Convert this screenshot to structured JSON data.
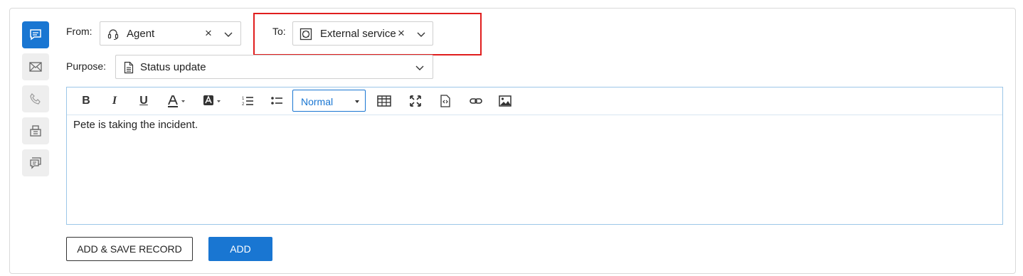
{
  "colors": {
    "accent": "#1976d2",
    "highlight": "#e01e1e"
  },
  "sidebar": {
    "items": [
      {
        "name": "comment",
        "icon": "comment-icon",
        "active": true
      },
      {
        "name": "email",
        "icon": "envelope-icon",
        "active": false
      },
      {
        "name": "phone",
        "icon": "phone-icon",
        "active": false
      },
      {
        "name": "fax",
        "icon": "fax-icon",
        "active": false
      },
      {
        "name": "chat",
        "icon": "chat-icon",
        "active": false
      }
    ]
  },
  "from": {
    "label": "From:",
    "value": "Agent",
    "icon": "headset-icon",
    "clear": "×"
  },
  "to": {
    "label": "To:",
    "value": "External service",
    "icon": "lifebuoy-icon",
    "clear": "×"
  },
  "purpose": {
    "label": "Purpose:",
    "value": "Status update",
    "icon": "document-icon"
  },
  "toolbar": {
    "bold": "B",
    "italic": "I",
    "underline": "U",
    "format_value": "Normal",
    "icons": [
      "bold-icon",
      "italic-icon",
      "underline-icon",
      "font-color-icon",
      "background-color-icon",
      "ordered-list-icon",
      "unordered-list-icon",
      "table-icon",
      "fullscreen-icon",
      "source-icon",
      "link-icon",
      "image-icon"
    ]
  },
  "editor": {
    "text": "Pete is taking the incident."
  },
  "actions": {
    "add_save": "ADD & SAVE RECORD",
    "add": "ADD"
  }
}
